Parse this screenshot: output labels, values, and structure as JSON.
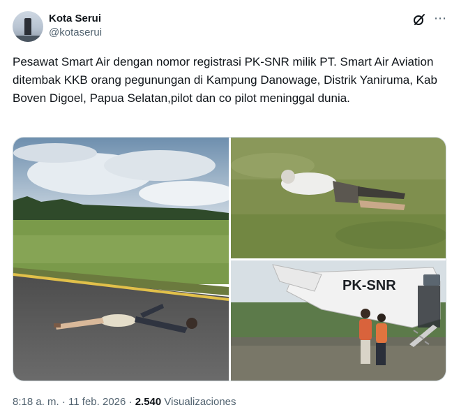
{
  "author": {
    "display_name": "Kota Serui",
    "handle": "@kotaserui"
  },
  "tweet": {
    "text": "Pesawat Smart Air dengan nomor registrasi PK-SNR milik PT. Smart Air Aviation ditembak KKB orang pegunungan di Kampung Danowage, Distrik Yaniruma, Kab Boven Digoel, Papua Selatan,pilot dan co pilot meninggal dunia."
  },
  "media": {
    "aircraft_registration": "PK-SNR"
  },
  "meta": {
    "time": "8:18 a. m.",
    "separator": " · ",
    "date": "11 feb. 2026",
    "views_count": "2.540",
    "views_label": "Visualizaciones"
  },
  "icons": {
    "grok": "grok-icon",
    "more": "more-icon"
  }
}
